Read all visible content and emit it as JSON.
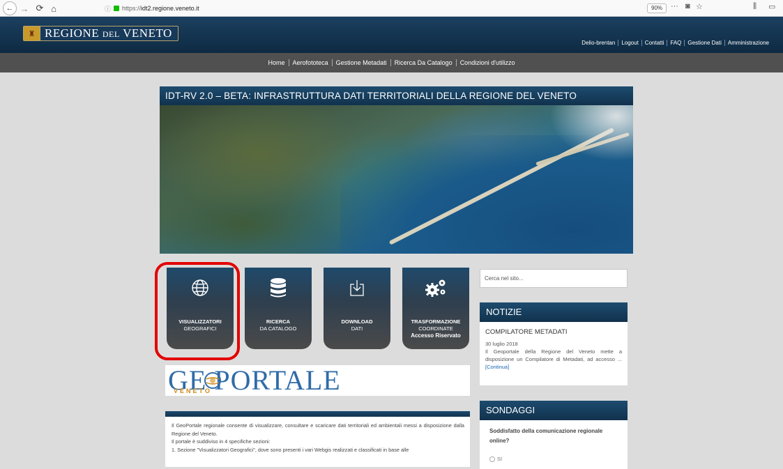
{
  "browser": {
    "url_prefix": "https://",
    "url_host": "idt2.regione.veneto.it",
    "zoom": "90%"
  },
  "header": {
    "logo_word1": "REGIONE",
    "logo_word2": "DEL",
    "logo_word3": "VENETO",
    "user_links": [
      "Delio-brentan",
      "Logout",
      "Contatti",
      "FAQ",
      "Gestione Dati",
      "Amministrazione"
    ]
  },
  "nav": {
    "items": [
      "Home",
      "Aerofototeca",
      "Gestione Metadati",
      "Ricerca Da Catalogo",
      "Condizioni d'utilizzo"
    ]
  },
  "banner": {
    "title": "IDT-RV 2.0 – BETA: INFRASTRUTTURA DATI TERRITORIALI DELLA REGIONE DEL VENETO"
  },
  "tiles": [
    {
      "line1": "VISUALIZZATORI",
      "line2": "GEOGRAFICI",
      "icon": "globe-icon"
    },
    {
      "line1": "RICERCA",
      "line2": "DA CATALOGO",
      "icon": "database-icon"
    },
    {
      "line1": "DOWNLOAD",
      "line2": "DATI",
      "icon": "download-icon"
    },
    {
      "line1": "TRASFORMAZIONE",
      "line2": "COORDINATE",
      "line3": "Accesso Riservato",
      "icon": "gears-icon"
    }
  ],
  "geoportale": {
    "logo_text": "GE PORTALE",
    "sub": "VENETO"
  },
  "description": {
    "lines": [
      "Il GeoPortale regionale consente di visualizzare, consultare e scaricare dati territoriali ed ambientali messi a disposizione dalla Regione del Veneto.",
      "Il portale è suddiviso in 4 specifiche sezioni:",
      "1.  Sezione \"Visualizzatori Geografici\", dove sono presenti i vari Webgis realizzati e classificati in base alle"
    ]
  },
  "search": {
    "placeholder": "Cerca nel sito..."
  },
  "news": {
    "title": "NOTIZIE",
    "item_title": "COMPILATORE METADATI",
    "date": "30 luglio 2018",
    "text": "Il Geoportale della Regione del Veneto mette a disposizione un Compilatore di Metadati, ad accesso ...",
    "link": "[Continua]"
  },
  "poll": {
    "title": "SONDAGGI",
    "question": "Soddisfatto della comunicazione regionale online?",
    "option1": "SI"
  }
}
